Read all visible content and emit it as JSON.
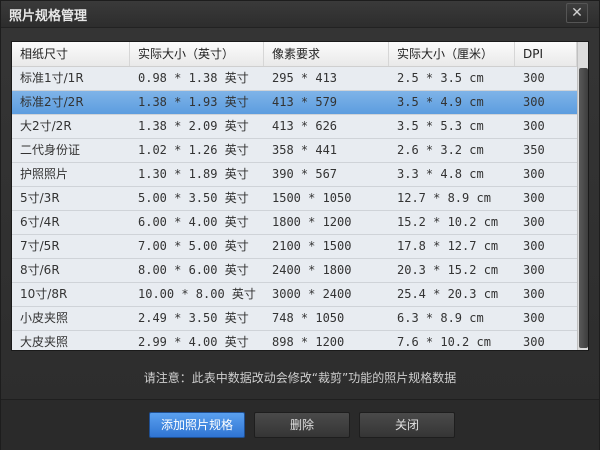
{
  "window": {
    "title": "照片规格管理",
    "close_glyph": "✕"
  },
  "table": {
    "headers": [
      "相纸尺寸",
      "实际大小（英寸）",
      "像素要求",
      "实际大小（厘米）",
      "DPI"
    ],
    "selected_row": 1,
    "rows": [
      [
        "标准1寸/1R",
        "0.98 * 1.38 英寸",
        "295 * 413",
        "2.5 * 3.5 cm",
        "300"
      ],
      [
        "标准2寸/2R",
        "1.38 * 1.93 英寸",
        "413 * 579",
        "3.5 * 4.9 cm",
        "300"
      ],
      [
        "大2寸/2R",
        "1.38 * 2.09 英寸",
        "413 * 626",
        "3.5 * 5.3 cm",
        "300"
      ],
      [
        "二代身份证",
        "1.02 * 1.26 英寸",
        "358 * 441",
        "2.6 * 3.2 cm",
        "350"
      ],
      [
        "护照照片",
        "1.30 * 1.89 英寸",
        "390 * 567",
        "3.3 * 4.8 cm",
        "300"
      ],
      [
        "5寸/3R",
        "5.00 * 3.50 英寸",
        "1500 * 1050",
        "12.7 * 8.9 cm",
        "300"
      ],
      [
        "6寸/4R",
        "6.00 * 4.00 英寸",
        "1800 * 1200",
        "15.2 * 10.2 cm",
        "300"
      ],
      [
        "7寸/5R",
        "7.00 * 5.00 英寸",
        "2100 * 1500",
        "17.8 * 12.7 cm",
        "300"
      ],
      [
        "8寸/6R",
        "8.00 * 6.00 英寸",
        "2400 * 1800",
        "20.3 * 15.2 cm",
        "300"
      ],
      [
        "10寸/8R",
        "10.00 * 8.00 英寸",
        "3000 * 2400",
        "25.4 * 20.3 cm",
        "300"
      ],
      [
        "小皮夹照",
        "2.49 * 3.50 英寸",
        "748 * 1050",
        "6.3 * 8.9 cm",
        "300"
      ],
      [
        "大皮夹照",
        "2.99 * 4.00 英寸",
        "898 * 1200",
        "7.6 * 10.2 cm",
        "300"
      ]
    ]
  },
  "note": "请注意：此表中数据改动会修改“裁剪”功能的照片规格数据",
  "buttons": {
    "add": "添加照片规格",
    "delete": "删除",
    "close": "关闭"
  },
  "colors": {
    "selected_row": "#6aa6e4",
    "primary_button": "#3f86de"
  }
}
